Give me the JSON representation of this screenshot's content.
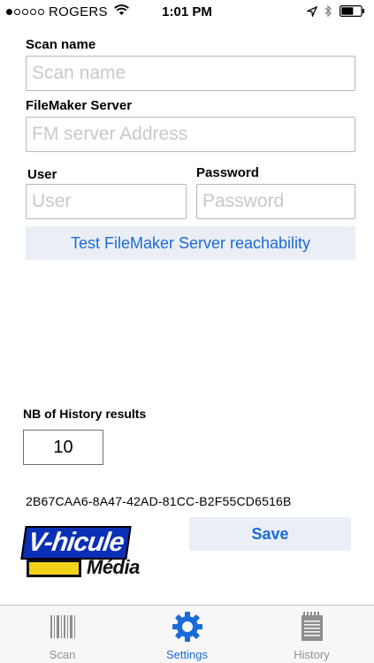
{
  "status_bar": {
    "carrier": "ROGERS",
    "time": "1:01 PM"
  },
  "form": {
    "scan_name_label": "Scan name",
    "scan_name_placeholder": "Scan name",
    "server_label": "FileMaker Server",
    "server_placeholder": "FM server Address",
    "user_label": "User",
    "user_placeholder": "User",
    "password_label": "Password",
    "password_placeholder": "Password",
    "test_button": "Test FileMaker Server reachability"
  },
  "history": {
    "label": "NB of History results",
    "value": "10"
  },
  "device_id": "2B67CAA6-8A47-42AD-81CC-B2F55CD6516B",
  "save_button": "Save",
  "logo": {
    "top_text": "V-hicule",
    "bottom_text": "Média"
  },
  "tabs": [
    {
      "label": "Scan",
      "icon": "barcode-icon"
    },
    {
      "label": "Settings",
      "icon": "gear-icon",
      "active": true
    },
    {
      "label": "History",
      "icon": "notepad-icon"
    }
  ],
  "colors": {
    "accent": "#1a6ad9",
    "button_bg": "#ebeef5",
    "tab_inactive": "#929292",
    "logo_blue": "#0b2fb5",
    "logo_yellow": "#f3d21a"
  }
}
